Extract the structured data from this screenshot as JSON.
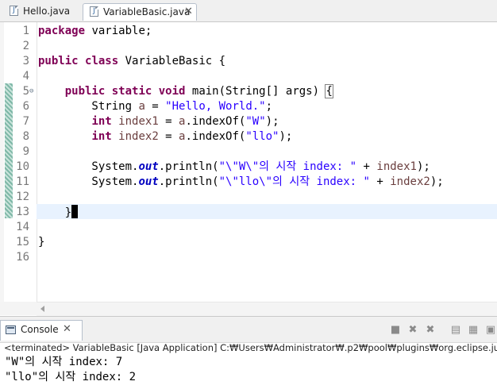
{
  "editor_tabs": [
    {
      "label": "Hello.java",
      "icon": "java-file-icon",
      "active": false
    },
    {
      "label": "VariableBasic.java",
      "icon": "java-file-icon",
      "active": true,
      "close": "✕"
    }
  ],
  "code_lines": [
    {
      "num": "1",
      "tokens": [
        {
          "t": "kw",
          "v": "package"
        },
        {
          "t": "plain",
          "v": " variable;"
        }
      ]
    },
    {
      "num": "2",
      "tokens": []
    },
    {
      "num": "3",
      "tokens": [
        {
          "t": "kw",
          "v": "public"
        },
        {
          "t": "plain",
          "v": " "
        },
        {
          "t": "kw",
          "v": "class"
        },
        {
          "t": "plain",
          "v": " VariableBasic {"
        }
      ]
    },
    {
      "num": "4",
      "tokens": []
    },
    {
      "num": "5",
      "fold": "⊖",
      "tokens": [
        {
          "t": "plain",
          "v": "    "
        },
        {
          "t": "kw",
          "v": "public"
        },
        {
          "t": "plain",
          "v": " "
        },
        {
          "t": "kw",
          "v": "static"
        },
        {
          "t": "plain",
          "v": " "
        },
        {
          "t": "kw",
          "v": "void"
        },
        {
          "t": "plain",
          "v": " main(String[] args) "
        },
        {
          "t": "brace",
          "v": "{"
        }
      ]
    },
    {
      "num": "6",
      "tokens": [
        {
          "t": "plain",
          "v": "        String "
        },
        {
          "t": "var",
          "v": "a"
        },
        {
          "t": "plain",
          "v": " = "
        },
        {
          "t": "str",
          "v": "\"Hello, World.\""
        },
        {
          "t": "plain",
          "v": ";"
        }
      ]
    },
    {
      "num": "7",
      "tokens": [
        {
          "t": "plain",
          "v": "        "
        },
        {
          "t": "kw",
          "v": "int"
        },
        {
          "t": "plain",
          "v": " "
        },
        {
          "t": "var",
          "v": "index1"
        },
        {
          "t": "plain",
          "v": " = "
        },
        {
          "t": "var",
          "v": "a"
        },
        {
          "t": "plain",
          "v": ".indexOf("
        },
        {
          "t": "str",
          "v": "\"W\""
        },
        {
          "t": "plain",
          "v": ");"
        }
      ]
    },
    {
      "num": "8",
      "tokens": [
        {
          "t": "plain",
          "v": "        "
        },
        {
          "t": "kw",
          "v": "int"
        },
        {
          "t": "plain",
          "v": " "
        },
        {
          "t": "var",
          "v": "index2"
        },
        {
          "t": "plain",
          "v": " = "
        },
        {
          "t": "var",
          "v": "a"
        },
        {
          "t": "plain",
          "v": ".indexOf("
        },
        {
          "t": "str",
          "v": "\"llo\""
        },
        {
          "t": "plain",
          "v": ");"
        }
      ]
    },
    {
      "num": "9",
      "tokens": []
    },
    {
      "num": "10",
      "tokens": [
        {
          "t": "plain",
          "v": "        System."
        },
        {
          "t": "fld",
          "v": "out"
        },
        {
          "t": "plain",
          "v": ".println("
        },
        {
          "t": "str",
          "v": "\"\\\"W\\\"의 시작 index: \""
        },
        {
          "t": "plain",
          "v": " + "
        },
        {
          "t": "var",
          "v": "index1"
        },
        {
          "t": "plain",
          "v": ");"
        }
      ]
    },
    {
      "num": "11",
      "tokens": [
        {
          "t": "plain",
          "v": "        System."
        },
        {
          "t": "fld",
          "v": "out"
        },
        {
          "t": "plain",
          "v": ".println("
        },
        {
          "t": "str",
          "v": "\"\\\"llo\\\"의 시작 index: \""
        },
        {
          "t": "plain",
          "v": " + "
        },
        {
          "t": "var",
          "v": "index2"
        },
        {
          "t": "plain",
          "v": ");"
        }
      ]
    },
    {
      "num": "12",
      "tokens": []
    },
    {
      "num": "13",
      "caret": true,
      "tokens": [
        {
          "t": "plain",
          "v": "    }"
        }
      ]
    },
    {
      "num": "14",
      "tokens": []
    },
    {
      "num": "15",
      "tokens": [
        {
          "t": "plain",
          "v": "}"
        }
      ]
    },
    {
      "num": "16",
      "tokens": []
    }
  ],
  "console": {
    "tab_label": "Console",
    "tab_close": "✕",
    "toolbar_icons": [
      "terminate-icon",
      "remove-launch-icon",
      "remove-all-terminated-icon",
      "scroll-lock-icon",
      "clear-console-icon",
      "pin-console-icon"
    ],
    "terminated_text": "<terminated> VariableBasic [Java Application] C:₩Users₩Administrator₩.p2₩pool₩plugins₩org.eclipse.justj.openjdk",
    "output_lines": [
      "\"W\"의 시작 index: 7",
      "\"llo\"의 시작 index: 2"
    ]
  }
}
